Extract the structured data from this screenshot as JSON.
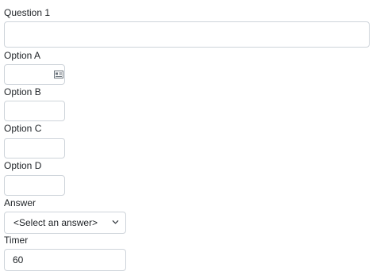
{
  "form": {
    "question_label": "Question 1",
    "question_value": "",
    "option_a_label": "Option A",
    "option_a_value": "",
    "option_b_label": "Option B",
    "option_b_value": "",
    "option_c_label": "Option C",
    "option_c_value": "",
    "option_d_label": "Option D",
    "option_d_value": "",
    "answer_label": "Answer",
    "answer_selected": "<Select an answer>",
    "timer_label": "Timer",
    "timer_value": "60"
  },
  "icons": {
    "autofill": "contact-card-icon",
    "select_arrow": "chevron-down-icon"
  },
  "colors": {
    "border": "#ced4da",
    "text": "#212529"
  }
}
